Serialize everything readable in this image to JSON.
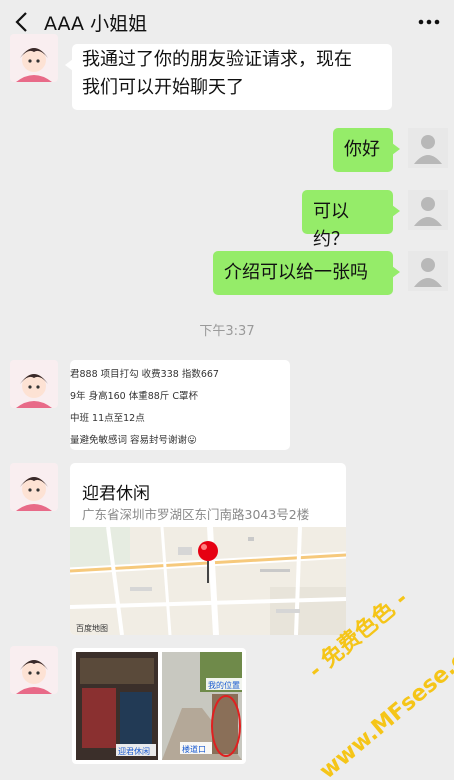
{
  "header": {
    "title": "AAA 小姐姐",
    "back_icon": "chevron-left-icon",
    "more_icon": "more-dots-icon"
  },
  "messages": [
    {
      "side": "left",
      "lines": [
        "我通过了你的朋友验证请求，现在",
        "我们可以开始聊天了"
      ]
    },
    {
      "side": "right",
      "text": "你好"
    },
    {
      "side": "right",
      "text": "可以约？"
    },
    {
      "side": "right",
      "text": "介绍可以给一张吗"
    }
  ],
  "timestamp": "下午3:37",
  "info_card": {
    "lines": [
      "君888 项目打勾 收费338 指数667",
      "9年 身高160 体重88斤 C罩杯",
      "中班 11点至12点",
      "量避免敏感词 容易封号谢谢😛"
    ]
  },
  "location": {
    "name": "迎君休闲",
    "address": "广东省深圳市罗湖区东门南路3043号2楼",
    "map_labels": [
      "百度地图"
    ]
  },
  "photo": {
    "labels": [
      "迎君休闲",
      "楼道口",
      "我的位置"
    ]
  },
  "watermark": {
    "line1": "- 免费色色 -",
    "line2": "www.MFsese.com"
  },
  "colors": {
    "bubble_self": "#95ec69",
    "bubble_other": "#ffffff",
    "background": "#ededed",
    "pin": "#e60012"
  }
}
